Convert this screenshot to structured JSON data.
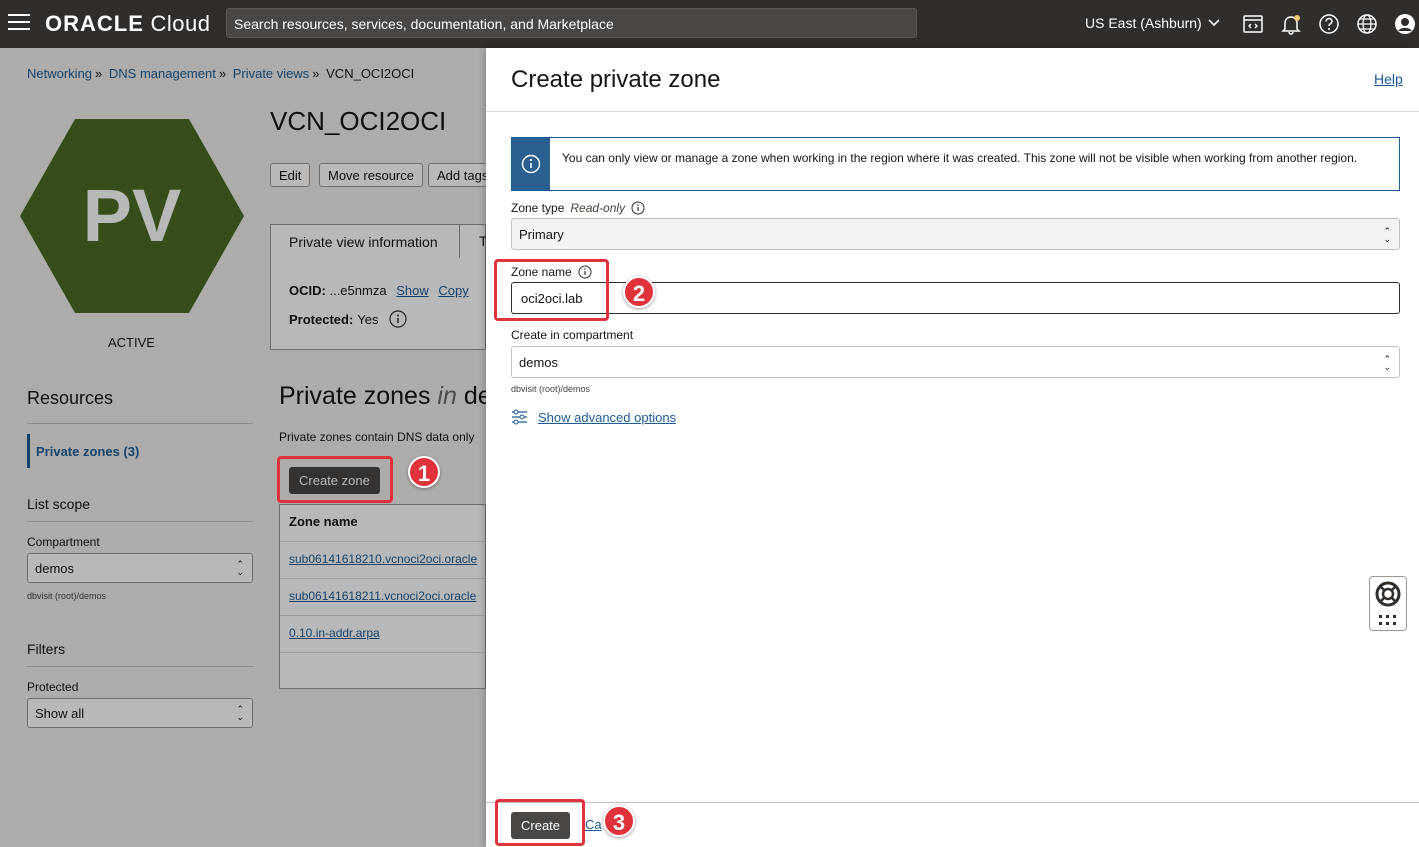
{
  "topbar": {
    "logo_oracle": "ORACLE",
    "logo_cloud": "Cloud",
    "search_placeholder": "Search resources, services, documentation, and Marketplace",
    "region": "US East (Ashburn)"
  },
  "breadcrumb": {
    "items": [
      "Networking",
      "DNS management",
      "Private views"
    ],
    "current": "VCN_OCI2OCI"
  },
  "resource": {
    "avatar_text": "PV",
    "avatar_color": "#4d6d25",
    "status": "ACTIVE",
    "title": "VCN_OCI2OCI",
    "actions": [
      "Edit",
      "Move resource",
      "Add tags"
    ],
    "tab_info": "Private view information",
    "tab_second_partial": "T",
    "ocid_label": "OCID:",
    "ocid_value": "...e5nmza",
    "show": "Show",
    "copy": "Copy",
    "protected_label": "Protected:",
    "protected_value": "Yes"
  },
  "sidebar": {
    "resources_heading": "Resources",
    "private_zones_link": "Private zones (3)",
    "list_scope_heading": "List scope",
    "compartment_label": "Compartment",
    "compartment_value": "demos",
    "compartment_path": "dbvisit (root)/demos",
    "filters_heading": "Filters",
    "protected_label": "Protected",
    "protected_value": "Show all"
  },
  "private_zones": {
    "title_prefix": "Private zones",
    "title_in": "in",
    "title_suffix_partial": "de",
    "description_partial": "Private zones contain DNS data only",
    "create_zone_button": "Create zone",
    "column_zone_name": "Zone name",
    "rows": [
      "sub06141618210.vcnoci2oci.oracle",
      "sub06141618211.vcnoci2oci.oracle",
      "0.10.in-addr.arpa"
    ]
  },
  "panel": {
    "title": "Create private zone",
    "help": "Help",
    "notice": "You can only view or manage a zone when working in the region where it was created. This zone will not be visible when working from another region.",
    "zone_type_label": "Zone type",
    "zone_type_readonly": "Read-only",
    "zone_type_value": "Primary",
    "zone_name_label": "Zone name",
    "zone_name_value": "oci2oci.lab",
    "compartment_label": "Create in compartment",
    "compartment_value": "demos",
    "compartment_path": "dbvisit (root)/demos",
    "advanced_options": "Show advanced options",
    "create_button": "Create",
    "cancel_partial": "Ca"
  },
  "annotations": {
    "step1": "1",
    "step2": "2",
    "step3": "3",
    "highlight_color": "#e0323a"
  }
}
